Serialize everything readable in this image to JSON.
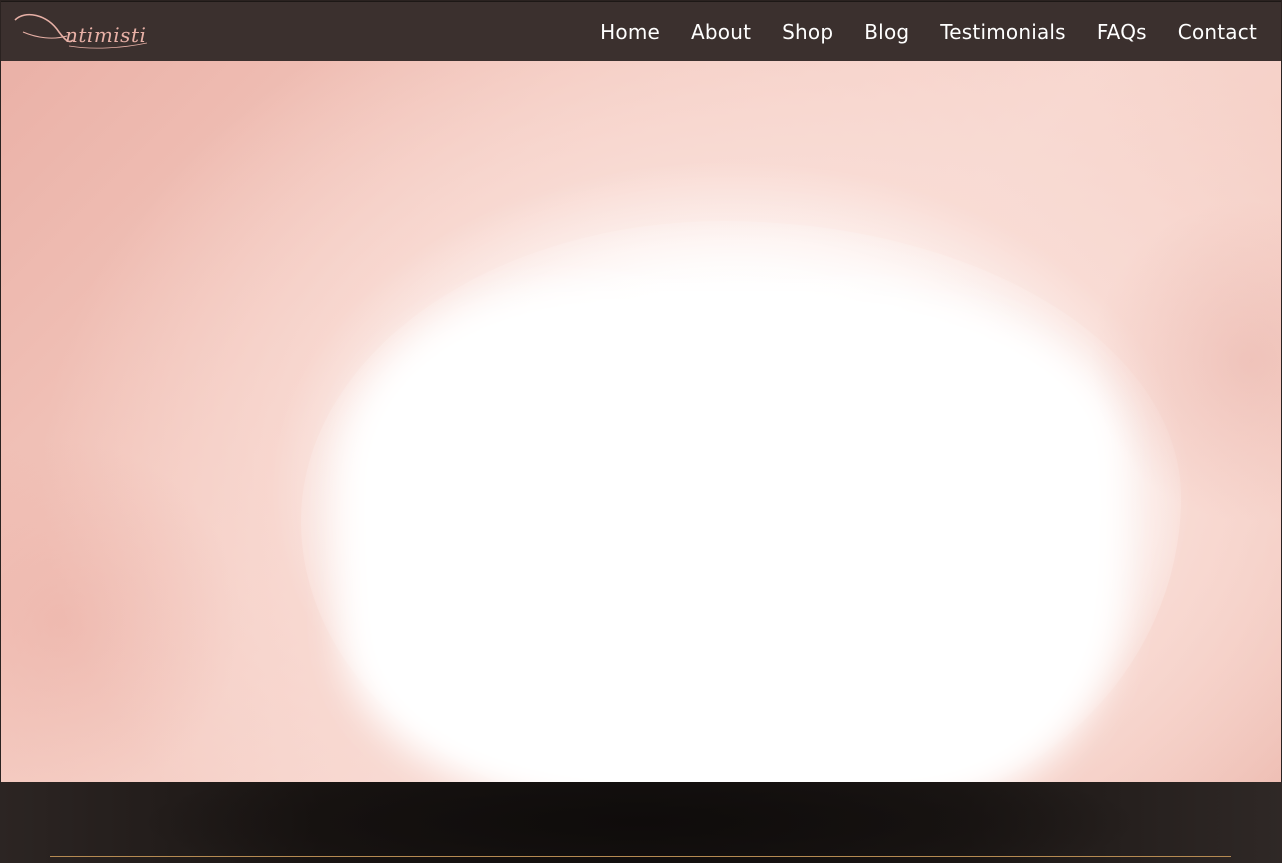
{
  "brand": {
    "logo_text": "intimisti",
    "logo_color": "#e7b0a6"
  },
  "nav": {
    "items": [
      {
        "label": "Home"
      },
      {
        "label": "About"
      },
      {
        "label": "Shop"
      },
      {
        "label": "Blog"
      },
      {
        "label": "Testimonials"
      },
      {
        "label": "FAQs"
      },
      {
        "label": "Contact"
      }
    ]
  },
  "colors": {
    "header_bg": "#3b302e",
    "nav_text": "#ffffff",
    "hero_pink": "#f3c7bd",
    "footer_bg": "#1a1513",
    "divider_gold": "#b58a52"
  }
}
